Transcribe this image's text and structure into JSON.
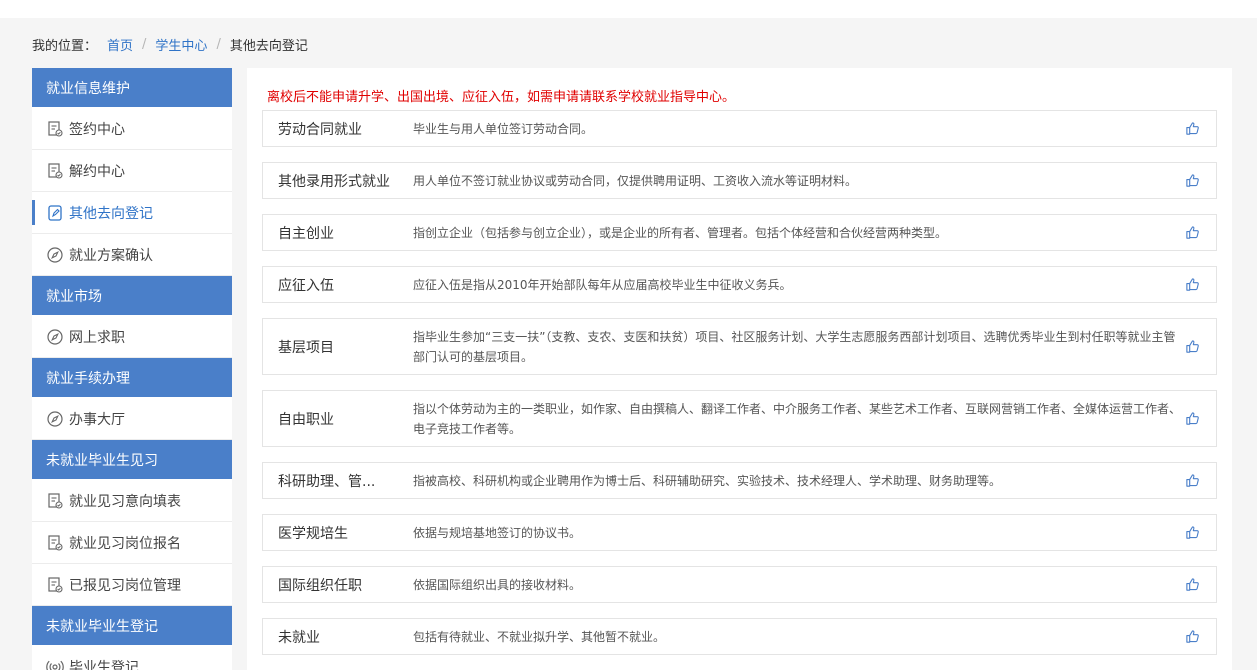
{
  "breadcrumb": {
    "label": "我的位置：",
    "items": [
      "首页",
      "学生中心"
    ],
    "separator": "/",
    "current": "其他去向登记"
  },
  "sidebar": {
    "sections": [
      {
        "title": "就业信息维护",
        "items": [
          {
            "label": "签约中心",
            "icon": "document-check-icon"
          },
          {
            "label": "解约中心",
            "icon": "document-check-icon"
          },
          {
            "label": "其他去向登记",
            "icon": "document-edit-icon",
            "active": true
          },
          {
            "label": "就业方案确认",
            "icon": "compass-icon"
          }
        ]
      },
      {
        "title": "就业市场",
        "items": [
          {
            "label": "网上求职",
            "icon": "compass-icon"
          }
        ]
      },
      {
        "title": "就业手续办理",
        "items": [
          {
            "label": "办事大厅",
            "icon": "compass-icon"
          }
        ]
      },
      {
        "title": "未就业毕业生见习",
        "items": [
          {
            "label": "就业见习意向填表",
            "icon": "document-check-icon"
          },
          {
            "label": "就业见习岗位报名",
            "icon": "document-check-icon"
          },
          {
            "label": "已报见习岗位管理",
            "icon": "document-check-icon"
          }
        ]
      },
      {
        "title": "未就业毕业生登记",
        "items": [
          {
            "label": "毕业生登记",
            "icon": "broadcast-icon"
          }
        ]
      }
    ]
  },
  "main": {
    "notice": "离校后不能申请升学、出国出境、应征入伍，如需申请请联系学校就业指导中心。",
    "notice_color": "#e00000",
    "rows": [
      {
        "name": "劳动合同就业",
        "desc": "毕业生与用人单位签订劳动合同。"
      },
      {
        "name": "其他录用形式就业",
        "desc": "用人单位不签订就业协议或劳动合同，仅提供聘用证明、工资收入流水等证明材料。"
      },
      {
        "name": "自主创业",
        "desc": "指创立企业（包括参与创立企业），或是企业的所有者、管理者。包括个体经营和合伙经营两种类型。"
      },
      {
        "name": "应征入伍",
        "desc": "应征入伍是指从2010年开始部队每年从应届高校毕业生中征收义务兵。"
      },
      {
        "name": "基层项目",
        "desc": "指毕业生参加“三支一扶”（支教、支农、支医和扶贫）项目、社区服务计划、大学生志愿服务西部计划项目、选聘优秀毕业生到村任职等就业主管部门认可的基层项目。"
      },
      {
        "name": "自由职业",
        "desc": "指以个体劳动为主的一类职业，如作家、自由撰稿人、翻译工作者、中介服务工作者、某些艺术工作者、互联网营销工作者、全媒体运营工作者、电子竞技工作者等。"
      },
      {
        "name": "科研助理、管...",
        "desc": "指被高校、科研机构或企业聘用作为博士后、科研辅助研究、实验技术、技术经理人、学术助理、财务助理等。"
      },
      {
        "name": "医学规培生",
        "desc": "依据与规培基地签订的协议书。"
      },
      {
        "name": "国际组织任职",
        "desc": "依据国际组织出具的接收材料。"
      },
      {
        "name": "未就业",
        "desc": "包括有待就业、不就业拟升学、其他暂不就业。"
      }
    ],
    "row_icon": "thumbs-up-icon"
  },
  "colors": {
    "accent": "#4a7fc9",
    "link": "#2f73c7",
    "notice": "#e00000"
  }
}
